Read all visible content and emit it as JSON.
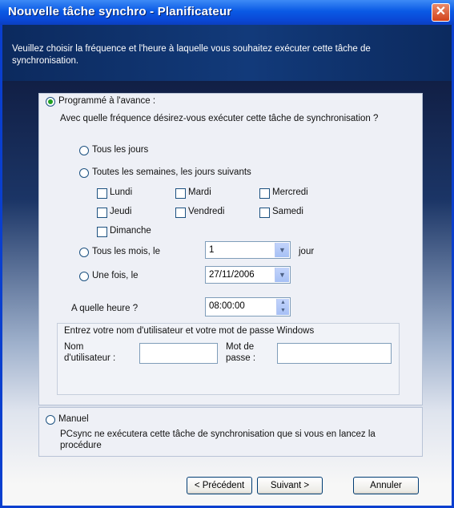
{
  "window": {
    "title": "Nouvelle tâche synchro - Planificateur",
    "close_glyph": "✕"
  },
  "header": {
    "description": "Veuillez choisir la fréquence et l'heure à laquelle vous souhaitez exécuter cette tâche de synchronisation."
  },
  "schedule": {
    "advanced_label": "Programmé à l'avance :",
    "question": "Avec quelle fréquence désirez-vous exécuter cette tâche de synchronisation ?",
    "daily_label": "Tous les jours",
    "weekly_label": "Toutes les semaines, les jours suivants",
    "days": [
      "Lundi",
      "Mardi",
      "Mercredi",
      "Jeudi",
      "Vendredi",
      "Samedi",
      "Dimanche"
    ],
    "monthly_label": "Tous les mois, le",
    "monthly_value": "1",
    "jour_label": "jour",
    "once_label": "Une fois, le",
    "once_value": "27/11/2006",
    "time_label": "A quelle heure ?",
    "time_value": "08:00:00",
    "credentials_prompt": "Entrez votre nom d'utilisateur et votre mot de passe Windows",
    "username_label": "Nom d'utilisateur :",
    "password_label": "Mot de passe :"
  },
  "manual": {
    "label": "Manuel",
    "note": "PCsync ne exécutera cette tâche de synchronisation que si vous en lancez la procédure"
  },
  "footer": {
    "back_label": "< Précédent",
    "next_label": "Suivant >",
    "cancel_label": "Annuler"
  }
}
